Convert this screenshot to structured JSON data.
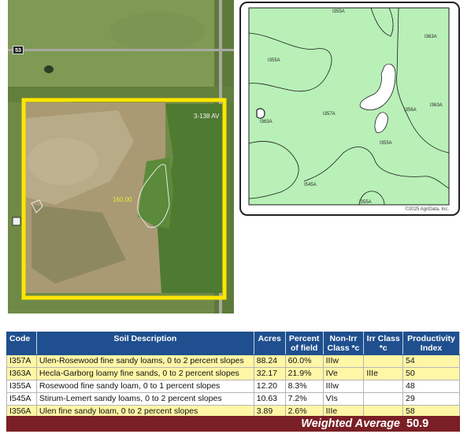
{
  "aerial": {
    "highway_shield": "53",
    "road_label": "3-138 AV",
    "field_acres": "160.00"
  },
  "soil_map": {
    "labels": [
      "I355A",
      "I355A",
      "I357A",
      "I363A",
      "I363A",
      "I356A",
      "I363A",
      "I545A",
      "I355A",
      "I355A"
    ],
    "copyright": "©2025 AgriData, Inc.",
    "colors": {
      "soil_fill": "#b8f0b8",
      "soil_line": "#1a1a1a"
    }
  },
  "table": {
    "headers": {
      "code": "Code",
      "description": "Soil Description",
      "acres": "Acres",
      "percent_line1": "Percent",
      "percent_line2": "of field",
      "nonirr_line1": "Non-Irr",
      "nonirr_line2": "Class *c",
      "irr_line1": "Irr Class",
      "irr_line2": "*c",
      "prod_line1": "Productivity",
      "prod_line2": "Index"
    },
    "rows": [
      {
        "code": "I357A",
        "description": "Ulen-Rosewood fine sandy loams, 0 to 2 percent slopes",
        "acres": "88.24",
        "percent": "60.0%",
        "nonirr": "IIIw",
        "irr": "",
        "prod": "54"
      },
      {
        "code": "I363A",
        "description": "Hecla-Garborg loamy fine sands, 0 to 2 percent slopes",
        "acres": "32.17",
        "percent": "21.9%",
        "nonirr": "IVe",
        "irr": "IIIe",
        "prod": "50"
      },
      {
        "code": "I355A",
        "description": "Rosewood fine sandy loam, 0 to 1 percent slopes",
        "acres": "12.20",
        "percent": "8.3%",
        "nonirr": "IIIw",
        "irr": "",
        "prod": "48"
      },
      {
        "code": "I545A",
        "description": "Stirum-Lemert sandy loams, 0 to 2 percent slopes",
        "acres": "10.63",
        "percent": "7.2%",
        "nonirr": "VIs",
        "irr": "",
        "prod": "29"
      },
      {
        "code": "I356A",
        "description": "Ulen fine sandy loam, 0 to 2 percent slopes",
        "acres": "3.89",
        "percent": "2.6%",
        "nonirr": "IIIe",
        "irr": "",
        "prod": "58"
      }
    ],
    "weighted_label": "Weighted Average",
    "weighted_value": "50.9",
    "colors": {
      "header_bg": "#1f4f8e",
      "highlight_bg": "#fff6a6",
      "footer_bg": "#7a1f25"
    }
  }
}
